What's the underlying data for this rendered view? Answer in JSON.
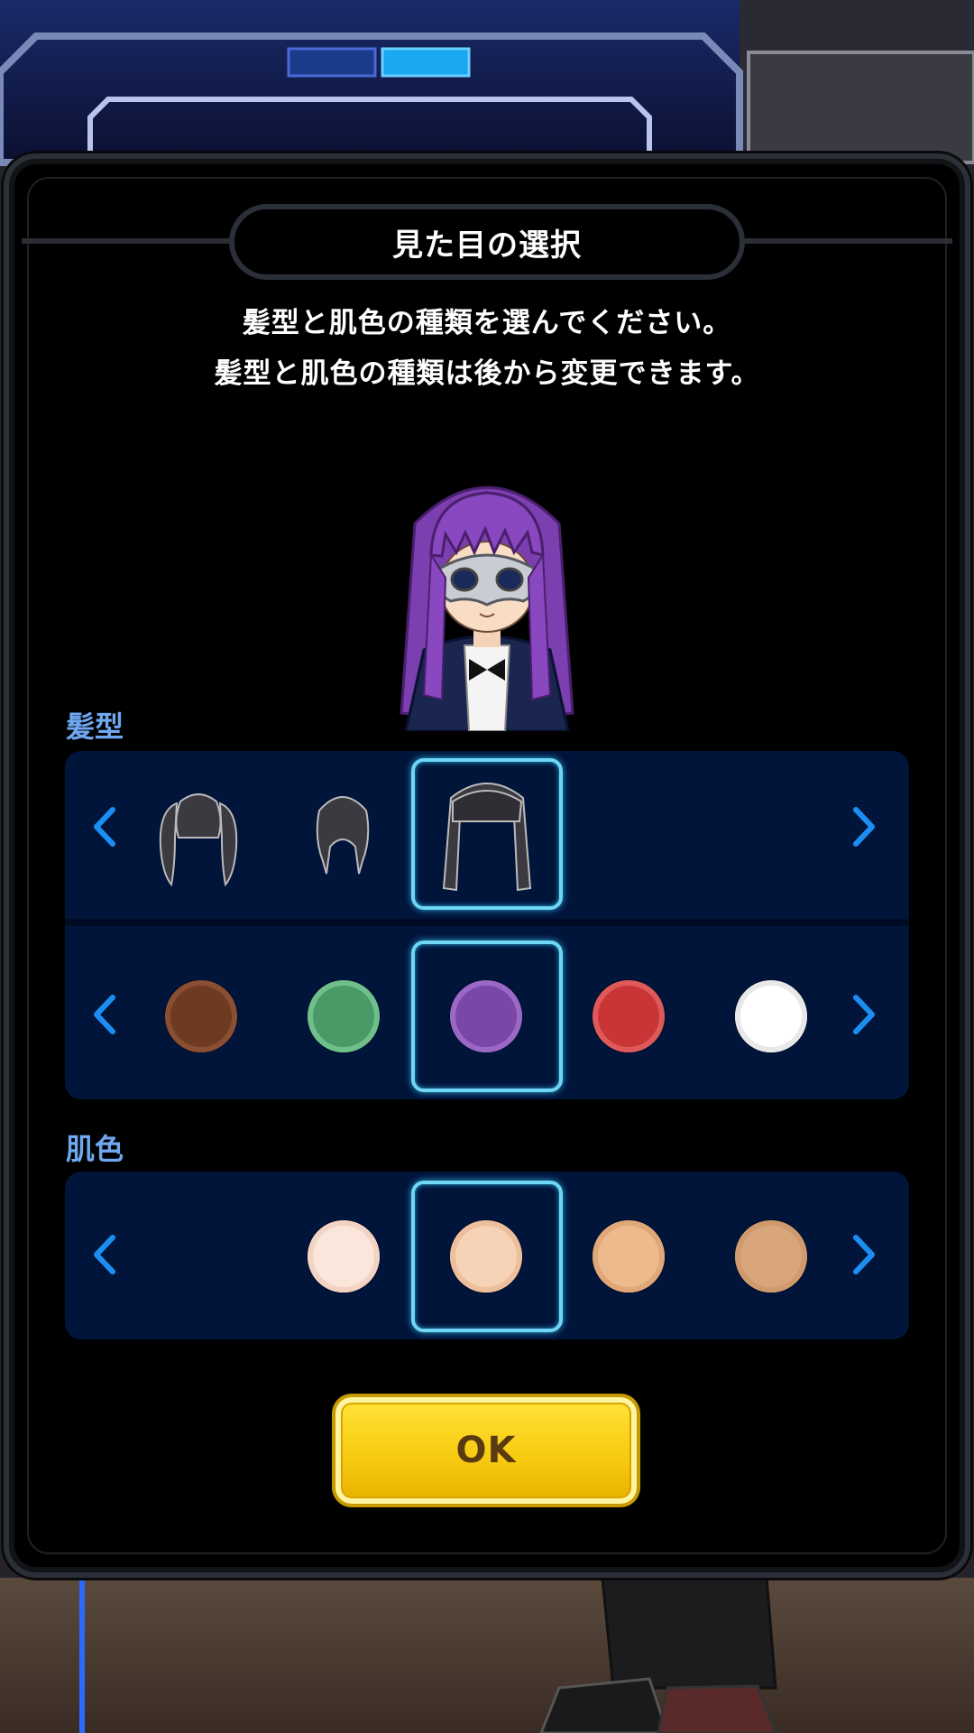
{
  "dialog": {
    "title": "見た目の選択",
    "description_line1": "髪型と肌色の種類を選んでください。",
    "description_line2": "髪型と肌色の種類は後から変更できます。"
  },
  "hair_section": {
    "label": "髪型",
    "styles": [
      {
        "name": "twin-tails-hair-icon",
        "selected": false
      },
      {
        "name": "short-hair-icon",
        "selected": false
      },
      {
        "name": "long-straight-hair-icon",
        "selected": true
      }
    ],
    "colors": [
      {
        "hex": "#6e3a22",
        "rim": "#8a4e32",
        "selected": false
      },
      {
        "hex": "#4a9a68",
        "rim": "#6fbf8a",
        "selected": false
      },
      {
        "hex": "#7a46a8",
        "rim": "#9a68c6",
        "selected": true
      },
      {
        "hex": "#c93434",
        "rim": "#de5a5a",
        "selected": false
      },
      {
        "hex": "#ffffff",
        "rim": "#e8e8e8",
        "selected": false
      }
    ]
  },
  "skin_section": {
    "label": "肌色",
    "colors": [
      {
        "hex": "#fbe6dc",
        "rim": "#f2d3c4",
        "selected": false
      },
      {
        "hex": "#f6d2b6",
        "rim": "#edbf9c",
        "selected": true
      },
      {
        "hex": "#ecba8c",
        "rim": "#e0a878",
        "selected": false
      },
      {
        "hex": "#d9a67c",
        "rim": "#cf9a6e",
        "selected": false
      }
    ]
  },
  "ok_button": {
    "label": "OK"
  },
  "colors": {
    "accent_blue": "#1c8ef2",
    "selection_frame": "#6fd6f6",
    "panel_bg": "#01143a",
    "section_label": "#6fa8f0",
    "button_yellow": "#f8cc12"
  }
}
